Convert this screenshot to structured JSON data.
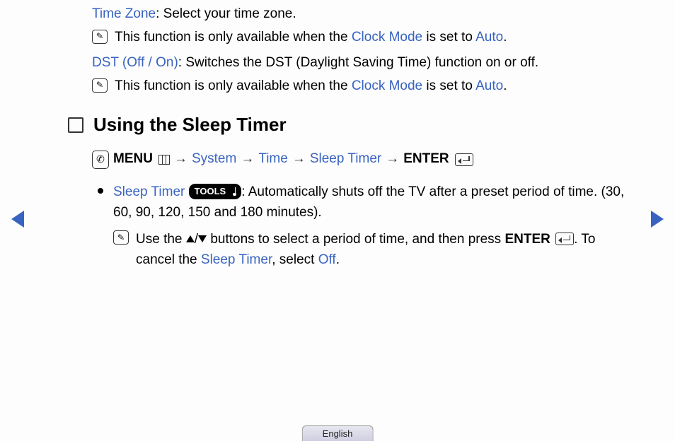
{
  "timeZone": {
    "label": "Time Zone",
    "desc": ": Select your time zone."
  },
  "note1": {
    "prefix": "This function is only available when the ",
    "link1": "Clock Mode",
    "mid": " is set to ",
    "link2": "Auto",
    "suffix": "."
  },
  "dst": {
    "label": "DST (Off / On)",
    "desc": ": Switches the DST (Daylight Saving Time) function on or off."
  },
  "note2": {
    "prefix": "This function is only available when the ",
    "link1": "Clock Mode",
    "mid": " is set to ",
    "link2": "Auto",
    "suffix": "."
  },
  "heading": "Using the Sleep Timer",
  "path": {
    "menu": "MENU",
    "arrow": "→",
    "system": "System",
    "time": "Time",
    "sleepTimer": "Sleep Timer",
    "enter": "ENTER"
  },
  "sleepTimer": {
    "label": "Sleep Timer",
    "tools": "TOOLS",
    "desc": ": Automatically shuts off the TV after a preset period of time. (30, 60, 90, 120, 150 and 180 minutes)."
  },
  "note3": {
    "prefix": "Use the ",
    "mid1": " buttons to select a period of time, and then press ",
    "enter": "ENTER",
    "mid2": ". To cancel the ",
    "link1": "Sleep Timer",
    "mid3": ", select ",
    "link2": "Off",
    "suffix": "."
  },
  "slash": "/",
  "language": "English"
}
